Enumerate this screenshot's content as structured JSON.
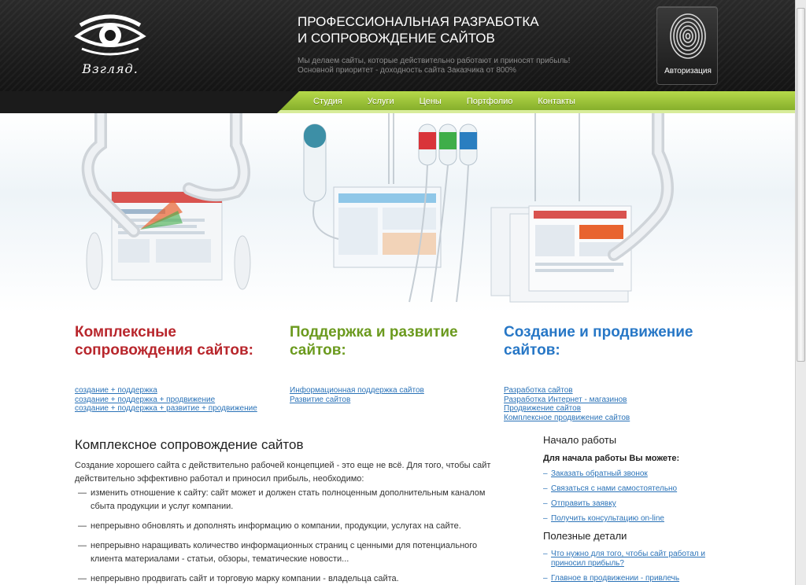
{
  "header": {
    "logo_text": "Взгляд.",
    "headline": "ПРОФЕССИОНАЛЬНАЯ РАЗРАБОТКА И СОПРОВОЖДЕНИЕ САЙТОВ",
    "subline_1": "Мы делаем сайты, которые действительно работают и приносят прибыль!",
    "subline_2": "Основной приоритет - доходность сайта Заказчика от 800%",
    "auth_label": "Авторизация"
  },
  "nav": {
    "items": [
      "Студия",
      "Услуги",
      "Цены",
      "Портфолио",
      "Контакты"
    ]
  },
  "services": [
    {
      "title": "Комплексные сопровождения сайтов:",
      "links": [
        "создание + поддержка",
        "создание + поддержка + продвижение",
        "создание + поддержка + развитие + продвижение"
      ]
    },
    {
      "title": "Поддержка и развитие сайтов:",
      "links": [
        "Информационная поддержка сайтов",
        "Развитие сайтов"
      ]
    },
    {
      "title": "Создание и продвижение сайтов:",
      "links": [
        "Разработка сайтов",
        "Разработка Интернет - магазинов",
        "Продвижение сайтов",
        "Комплексное продвижение сайтов"
      ]
    }
  ],
  "main": {
    "title": "Комплексное сопровождение сайтов",
    "intro": "Создание хорошего сайта с действительно рабочей концепцией - это еще не всё. Для того, чтобы сайт действительно эффективно работал и приносил прибыль, необходимо:",
    "bullets": [
      "изменить отношение к сайту: сайт может и должен стать полноценным дополнительным каналом сбыта продукции и услуг компании.",
      "непрерывно обновлять и дополнять информацию о компании, продукции, услугах на сайте.",
      "непрерывно наращивать количество информационных страниц с ценными для потенциального клиента материалами - статьи, обзоры, тематические новости...",
      "непрерывно продвигать сайт и торговую марку компании - владельца сайта."
    ]
  },
  "side": {
    "start_title": "Начало работы",
    "start_lead": "Для начала работы Вы можете:",
    "start_links": [
      "Заказать обратный звонок",
      "Связаться с нами самостоятельно",
      "Отправить заявку",
      "Получить консультацию on-line"
    ],
    "details_title": "Полезные детали",
    "details_links": [
      "Что нужно для того, чтобы сайт работал и приносил прибыль?",
      "Главное в продвижении - привлечь"
    ]
  }
}
